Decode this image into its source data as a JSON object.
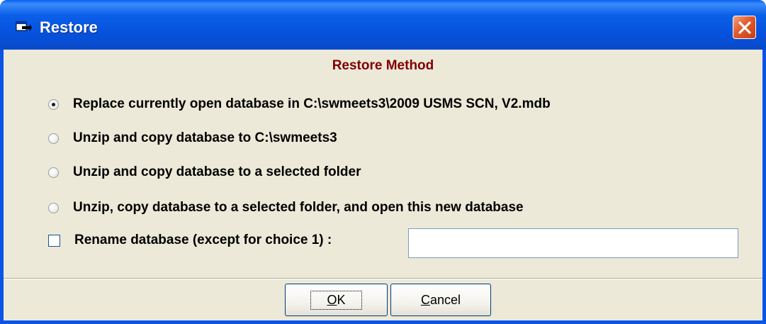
{
  "window": {
    "title": "Restore",
    "app_icon": "restore-window-icon",
    "close_icon": "close-icon",
    "close_color": "#e35a2c",
    "titlebar_color": "#0551dc"
  },
  "dialog": {
    "heading": "Restore Method",
    "heading_color": "#800000",
    "options": [
      {
        "label": "Replace currently open database in C:\\swmeets3\\2009 USMS SCN, V2.mdb",
        "selected": true
      },
      {
        "label": "Unzip and copy database to C:\\swmeets3",
        "selected": false
      },
      {
        "label": "Unzip and copy database to a selected folder",
        "selected": false
      },
      {
        "label": "Unzip, copy database to a selected folder, and open this new database",
        "selected": false
      }
    ],
    "rename": {
      "label": "Rename database (except for choice 1) :",
      "checked": false,
      "value": ""
    }
  },
  "buttons": {
    "ok_prefix": "",
    "ok_underlined": "O",
    "ok_rest": "K",
    "cancel_underlined": "C",
    "cancel_rest": "ancel"
  }
}
